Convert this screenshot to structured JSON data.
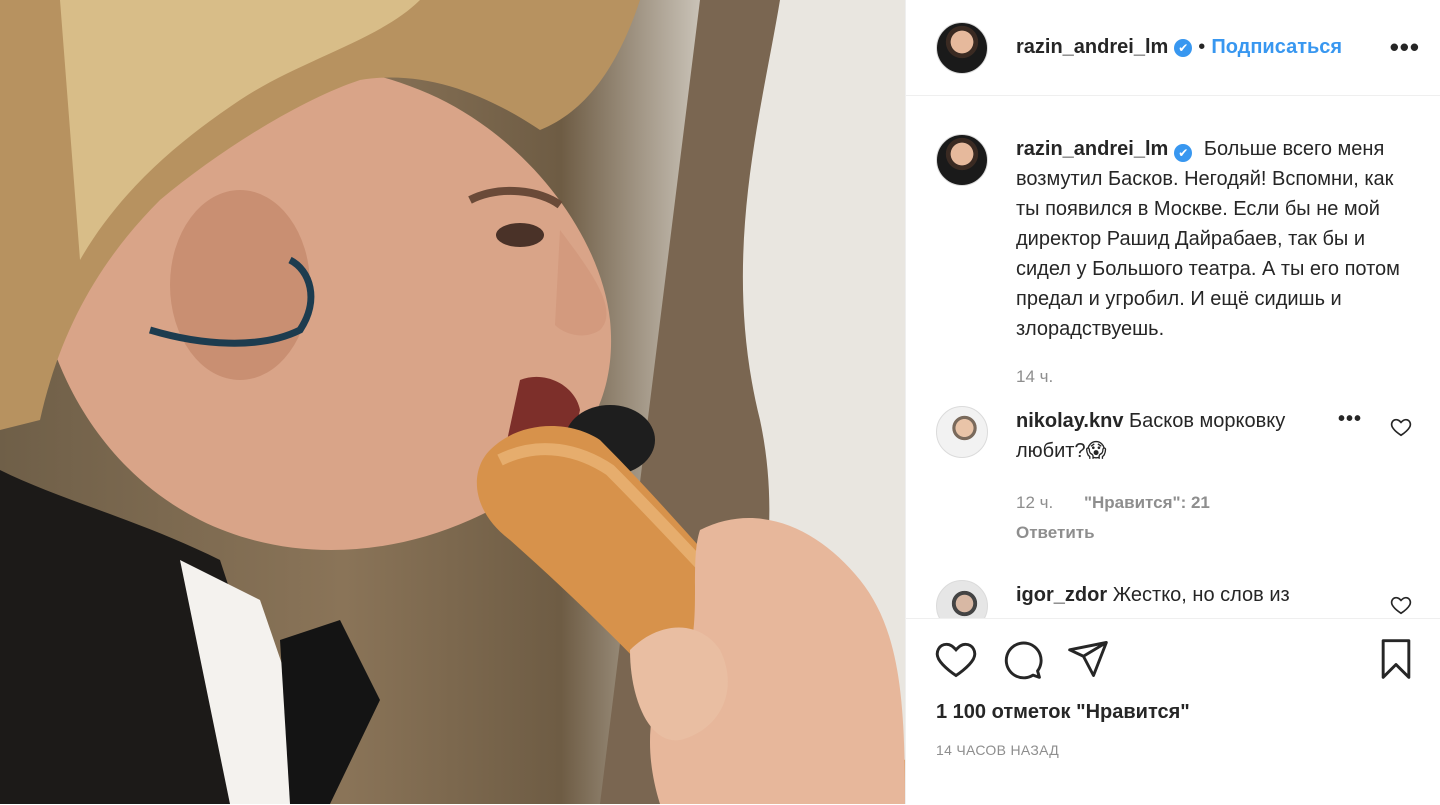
{
  "post": {
    "username": "razin_andrei_lm",
    "follow_label": "Подписаться",
    "separator": "•",
    "more_label": "•••",
    "verified_mark": "✔",
    "image_alt_icon": "photo",
    "caption": "Больше всего меня возмутил Басков. Негодяй! Вспомни, как ты появился в Москве. Если бы не мой директор Рашид Дайрабаев, так бы и сидел у Большого театра. А ты его потом предал и угробил. И ещё сидишь и злорадствуешь.",
    "caption_time": "14 ч.",
    "likes_text": "1 100 отметок \"Нравится\"",
    "posted_ago": "14 ЧАСОВ НАЗАД"
  },
  "comments": [
    {
      "username": "nikolay.knv",
      "text": "Басков морковку любит?😱",
      "time": "12 ч.",
      "likes": "\"Нравится\": 21",
      "reply_label": "Ответить",
      "more_label": "•••"
    },
    {
      "username": "igor_zdor",
      "text": "Жестко, но слов из"
    }
  ],
  "colors": {
    "accent": "#3897f0",
    "text": "#262626",
    "muted": "#8e8e8e",
    "border": "#efefef"
  },
  "icons": [
    "heart-icon",
    "comment-icon",
    "share-icon",
    "bookmark-icon",
    "more-icon",
    "verified-icon"
  ]
}
